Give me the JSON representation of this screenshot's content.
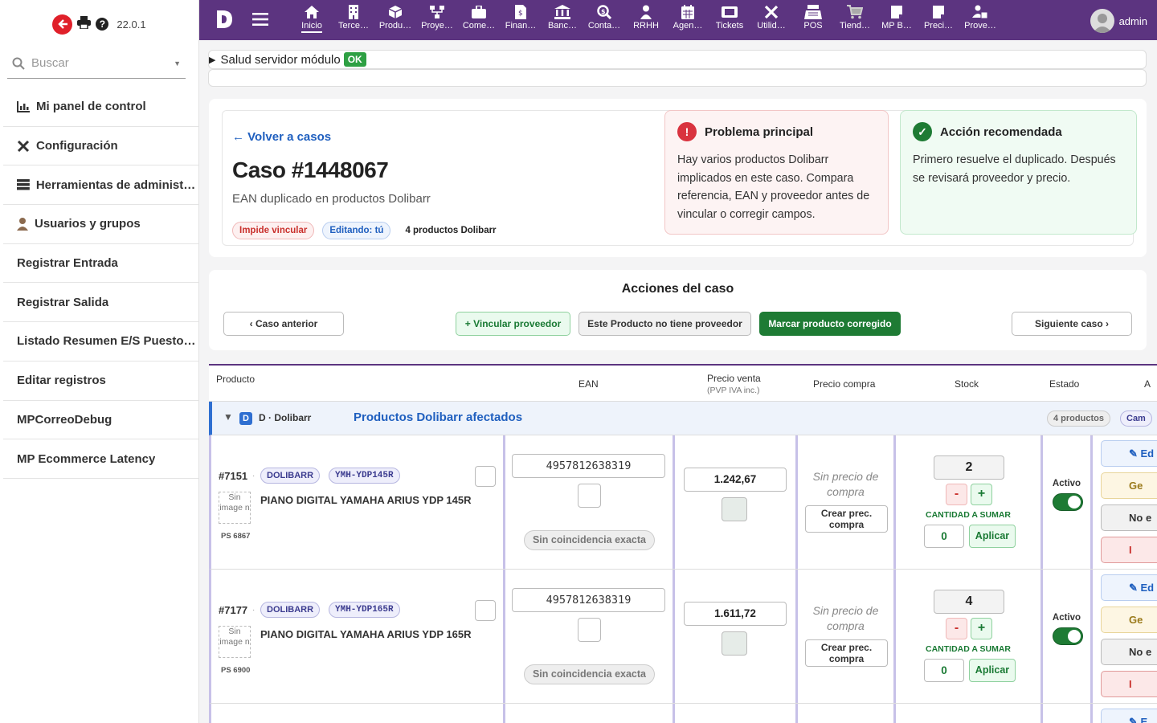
{
  "app": {
    "version": "22.0.1",
    "user": "admin"
  },
  "search": {
    "placeholder": "Buscar"
  },
  "sidebar": {
    "items": [
      {
        "label": "Mi panel de control",
        "icon": "chart-icon"
      },
      {
        "label": "Configuración",
        "icon": "tools-icon"
      },
      {
        "label": "Herramientas de administr…",
        "icon": "server-icon"
      },
      {
        "label": "Usuarios y grupos",
        "icon": "user-icon"
      },
      {
        "label": "Registrar Entrada"
      },
      {
        "label": "Registrar Salida"
      },
      {
        "label": "Listado Resumen E/S Puesto …"
      },
      {
        "label": "Editar registros"
      },
      {
        "label": "MPCorreoDebug"
      },
      {
        "label": "MP Ecommerce Latency"
      }
    ]
  },
  "topnav": {
    "items": [
      {
        "label": "Inicio",
        "icon": "home-icon"
      },
      {
        "label": "Terce…",
        "icon": "building-icon"
      },
      {
        "label": "Produ…",
        "icon": "cube-icon"
      },
      {
        "label": "Proye…",
        "icon": "sitemap-icon"
      },
      {
        "label": "Come…",
        "icon": "briefcase-icon"
      },
      {
        "label": "Finan…",
        "icon": "invoice-icon"
      },
      {
        "label": "Banc…",
        "icon": "bank-icon"
      },
      {
        "label": "Conta…",
        "icon": "search-dollar-icon"
      },
      {
        "label": "RRHH",
        "icon": "person-icon"
      },
      {
        "label": "Agen…",
        "icon": "calendar-icon"
      },
      {
        "label": "Tickets",
        "icon": "ticket-icon"
      },
      {
        "label": "Utilid…",
        "icon": "tools-icon"
      },
      {
        "label": "POS",
        "icon": "cash-register-icon"
      },
      {
        "label": "Tiend…",
        "icon": "cart-icon"
      },
      {
        "label": "MP B…",
        "icon": "doc-icon"
      },
      {
        "label": "Preci…",
        "icon": "doc-icon"
      },
      {
        "label": "Prove…",
        "icon": "people-icon"
      }
    ]
  },
  "health": {
    "label": "Salud servidor módulo",
    "status": "OK"
  },
  "case": {
    "back": "← Volver a casos",
    "title": "Caso #1448067",
    "subtitle": "EAN duplicado en productos Dolibarr",
    "chips": {
      "blocking": "Impide vincular",
      "editing": "Editando: tú",
      "count": "4 productos Dolibarr"
    },
    "problem": {
      "title": "Problema principal",
      "text": "Hay varios productos Dolibarr implicados en este caso. Compara referencia, EAN y proveedor antes de vincular o corregir campos."
    },
    "action": {
      "title": "Acción recomendada",
      "text": "Primero resuelve el duplicado. Después se revisará proveedor y precio."
    }
  },
  "actions": {
    "title": "Acciones del caso",
    "prev": "‹ Caso anterior",
    "link": "+ Vincular proveedor",
    "nosupplier": "Este Producto no tiene proveedor",
    "fixed": "Marcar producto corregido",
    "next": "Siguiente caso ›"
  },
  "table": {
    "headers": {
      "product": "Producto",
      "ean": "EAN",
      "sale": "Precio venta",
      "sale_sub": "(PVP IVA inc.)",
      "buy": "Precio compra",
      "stock": "Stock",
      "status": "Estado",
      "actions": "A"
    },
    "group": {
      "badge": "D",
      "label": "D · Dolibarr",
      "title": "Productos Dolibarr afectados",
      "count": "4 productos",
      "cut": "Cam"
    },
    "rows": [
      {
        "id": "#7151",
        "source": "DOLIBARR",
        "ref": "YMH-YDP145R",
        "noimg": "Sin image n",
        "ps": "PS 6867",
        "name": "PIANO DIGITAL YAMAHA ARIUS YDP 145R",
        "ean": "4957812638319",
        "match": "Sin coincidencia exacta",
        "price": "1.242,67",
        "buy": "Sin precio de compra",
        "create": "Crear prec. compra",
        "stock": "2",
        "qty_label": "CANTIDAD A SUMAR",
        "qty": "0",
        "apply": "Aplicar",
        "status": "Activo",
        "btns": [
          "✎ Ed",
          "Ge",
          "No e",
          "I"
        ]
      },
      {
        "id": "#7177",
        "source": "DOLIBARR",
        "ref": "YMH-YDP165R",
        "noimg": "Sin image n",
        "ps": "PS 6900",
        "name": "PIANO DIGITAL YAMAHA ARIUS YDP 165R",
        "ean": "4957812638319",
        "match": "Sin coincidencia exacta",
        "price": "1.611,72",
        "buy": "Sin precio de compra",
        "create": "Crear prec. compra",
        "stock": "4",
        "qty_label": "CANTIDAD A SUMAR",
        "qty": "0",
        "apply": "Aplicar",
        "status": "Activo",
        "btns": [
          "✎ Ed",
          "Ge",
          "No e",
          "I"
        ]
      }
    ],
    "partial_row_btn": "✎ E"
  }
}
